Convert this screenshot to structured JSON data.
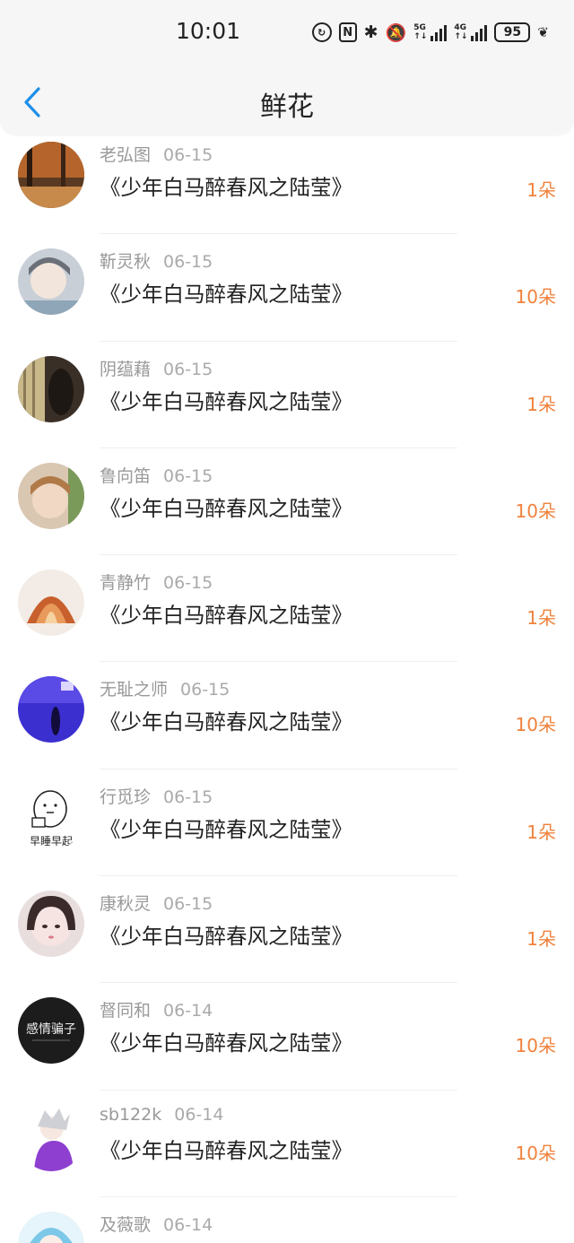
{
  "status_bar": {
    "time": "10:01",
    "signal_5g": "5G",
    "signal_4g": "4G",
    "battery": "95",
    "accent": "#222222"
  },
  "header": {
    "title": "鲜花",
    "back_icon": "chevron-left-icon",
    "back_color": "#1e8fe8"
  },
  "colors": {
    "flower_count": "#f0823c",
    "meta_text": "#999999"
  },
  "items": [
    {
      "user": "老弘图",
      "date": "06-15",
      "book": "《少年白马醉春风之陆莹》",
      "flowers": "1朵"
    },
    {
      "user": "靳灵秋",
      "date": "06-15",
      "book": "《少年白马醉春风之陆莹》",
      "flowers": "10朵"
    },
    {
      "user": "阴蕴藉",
      "date": "06-15",
      "book": "《少年白马醉春风之陆莹》",
      "flowers": "1朵"
    },
    {
      "user": "鲁向笛",
      "date": "06-15",
      "book": "《少年白马醉春风之陆莹》",
      "flowers": "10朵"
    },
    {
      "user": "青静竹",
      "date": "06-15",
      "book": "《少年白马醉春风之陆莹》",
      "flowers": "1朵"
    },
    {
      "user": "无耻之师",
      "date": "06-15",
      "book": "《少年白马醉春风之陆莹》",
      "flowers": "10朵"
    },
    {
      "user": "行觅珍",
      "date": "06-15",
      "book": "《少年白马醉春风之陆莹》",
      "flowers": "1朵",
      "avatar_text": "早睡早起"
    },
    {
      "user": "康秋灵",
      "date": "06-15",
      "book": "《少年白马醉春风之陆莹》",
      "flowers": "1朵"
    },
    {
      "user": "督同和",
      "date": "06-14",
      "book": "《少年白马醉春风之陆莹》",
      "flowers": "10朵",
      "avatar_text": "感情骗子"
    },
    {
      "user": "sb122k",
      "date": "06-14",
      "book": "《少年白马醉春风之陆莹》",
      "flowers": "10朵"
    },
    {
      "user": "及薇歌",
      "date": "06-14",
      "book": "",
      "flowers": ""
    }
  ]
}
